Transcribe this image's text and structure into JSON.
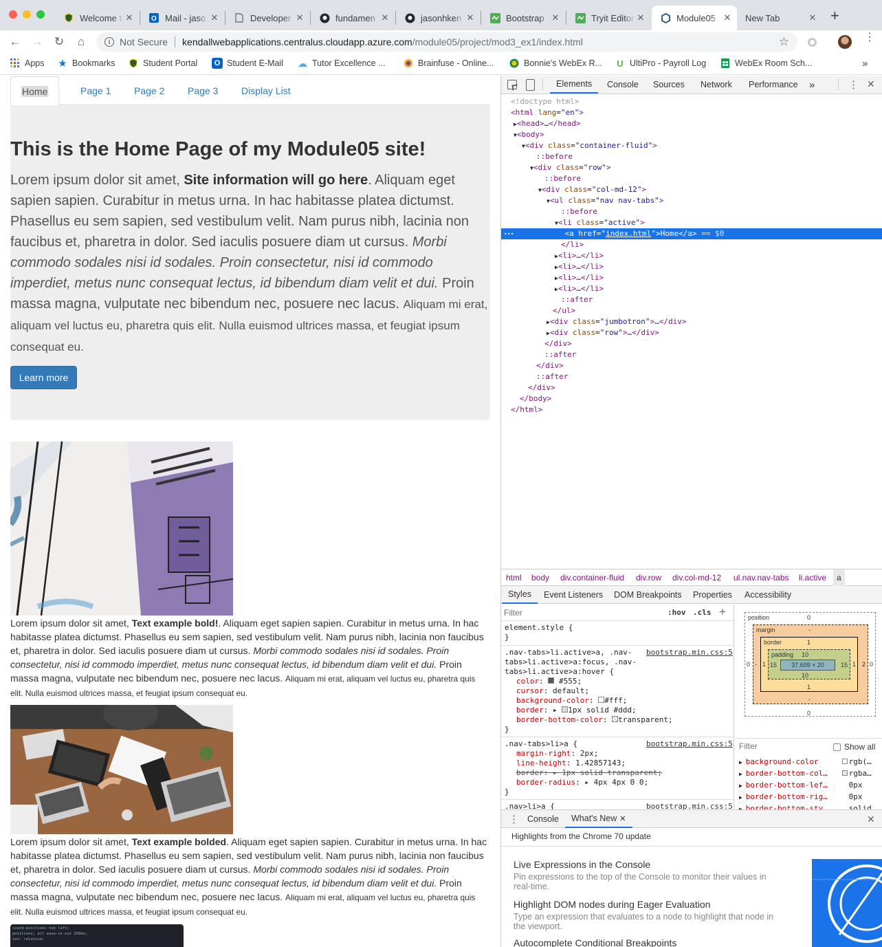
{
  "browser": {
    "tabs": [
      {
        "label": "Welcome t",
        "icon": "shield"
      },
      {
        "label": "Mail - jaso",
        "icon": "outlook"
      },
      {
        "label": "Developer",
        "icon": "doc"
      },
      {
        "label": "fundamen",
        "icon": "github"
      },
      {
        "label": "jasonhken",
        "icon": "github"
      },
      {
        "label": "Bootstrap",
        "icon": "tryit"
      },
      {
        "label": "Tryit Editor",
        "icon": "tryit"
      },
      {
        "label": "Module05",
        "icon": "azure"
      },
      {
        "label": "New Tab",
        "icon": ""
      }
    ],
    "security_label": "Not Secure",
    "url_host": "kendallwebapplications.centralus.cloudapp.azure.com",
    "url_path": "/module05/project/mod3_ex1/index.html",
    "bookmarks": [
      "Apps",
      "Bookmarks",
      "Student Portal",
      "Student E-Mail",
      "Tutor Excellence ...",
      "Brainfuse - Online...",
      "Bonnie's WebEx R...",
      "UltiPro - Payroll Log",
      "WebEx Room Sch..."
    ],
    "overflow_symbol": "»"
  },
  "site": {
    "nav": [
      "Home",
      "Page 1",
      "Page 2",
      "Page 3",
      "Display List"
    ],
    "heading": "This is the Home Page of my Module05 site!",
    "lead_1": "Lorem ipsum dolor sit amet, ",
    "lead_bold": "Site information will go here",
    "lead_2": ". Aliquam eget sapien sapien. Curabitur in metus urna. In hac habitasse platea dictumst. Phasellus eu sem sapien, sed vestibulum velit. Nam purus nibh, lacinia non faucibus et, pharetra in dolor. Sed iaculis posuere diam ut cursus. ",
    "lead_italic": "Morbi commodo sodales nisi id sodales. Proin consectetur, nisi id commodo imperdiet, metus nunc consequat lectus, id bibendum diam velit et dui.",
    "lead_3": " Proin massa magna, vulputate nec bibendum nec, posuere nec lacus. ",
    "lead_small": "Aliquam mi erat, aliquam vel luctus eu, pharetra quis elit. Nulla euismod ultrices massa, et feugiat ipsum consequat eu.",
    "learn_more": "Learn more",
    "para1_start": "Lorem ipsum dolor sit amet, ",
    "para1_bold": "Text example bold!",
    "para2_bold": "Text example bolded",
    "para_body": ". Aliquam eget sapien sapien. Curabitur in metus urna. In hac habitasse platea dictumst. Phasellus eu sem sapien, sed vestibulum velit. Nam purus nibh, lacinia non faucibus et, pharetra in dolor. Sed iaculis posuere diam ut cursus. ",
    "para_italic": "Morbi commodo sodales nisi id sodales. Proin consectetur, nisi id commodo imperdiet, metus nunc consequat lectus, id bibendum diam velit et dui.",
    "para_after": " Proin massa magna, vulputate nec bibendum nec, posuere nec lacus. ",
    "para_small": "Aliquam mi erat, aliquam vel luctus eu, pharetra quis elit. Nulla euismod ultrices massa, et feugiat ipsum consequat eu.",
    "code_lines": [
      "cound-positions top left;",
      "positions; all ease-in-out 250ms;",
      "ion: relative;"
    ]
  },
  "devtools": {
    "tabs": [
      "Elements",
      "Console",
      "Sources",
      "Network",
      "Performance"
    ],
    "more_symbol": "»",
    "dom": {
      "doctype": "<!doctype html>",
      "html_open": "html",
      "lang_attr": "lang",
      "lang_val": "\"en\"",
      "head": "head",
      "ellipsis": "…",
      "body": "body",
      "div": "div",
      "class_attr": "class",
      "container": "\"container-fluid\"",
      "row": "\"row\"",
      "col": "\"col-md-12\"",
      "ul": "ul",
      "navtabs": "\"nav nav-tabs\"",
      "li": "li",
      "active": "\"active\"",
      "a": "a",
      "href_attr": "href",
      "href_val": "index.html",
      "home": "Home",
      "sel_marker": "== $0",
      "before": "::before",
      "after": "::after",
      "jumbotron": "\"jumbotron\"",
      "dots": "•••"
    },
    "breadcrumbs": [
      "html",
      "body",
      "div.container-fluid",
      "div.row",
      "div.col-md-12",
      "ul.nav.nav-tabs",
      "li.active",
      "a"
    ],
    "subtabs": [
      "Styles",
      "Event Listeners",
      "DOM Breakpoints",
      "Properties",
      "Accessibility"
    ],
    "filter_placeholder": "Filter",
    "hov": ":hov",
    "cls": ".cls",
    "plus": "+",
    "styles": {
      "element_style": "element.style {",
      "close": "}",
      "rule1_sel": ".nav-tabs>li.active>a, .nav-tabs>li.active>a:focus, .nav-tabs>li.active>a:hover {",
      "rule1_src": "bootstrap.min.css:5",
      "rule1_props": [
        [
          "color",
          "#555;"
        ],
        [
          "cursor",
          "default;"
        ],
        [
          "background-color",
          "#fff;"
        ],
        [
          "border",
          "1px solid #ddd;"
        ],
        [
          "border-bottom-color",
          "transparent;"
        ]
      ],
      "rule2_sel": ".nav-tabs>li>a {",
      "rule2_src": "bootstrap.min.css:5",
      "rule2_props": [
        [
          "margin-right",
          "2px;"
        ],
        [
          "line-height",
          "1.42857143;"
        ],
        [
          "border",
          "1px solid transparent;"
        ],
        [
          "border-radius",
          "4px 4px 0 0;"
        ]
      ],
      "rule3_sel": ".nav>li>a {",
      "rule3_src": "bootstrap.min.css:5"
    },
    "boxmodel": {
      "position": "position",
      "margin": "margin",
      "border": "border",
      "padding": "padding",
      "content": "37.609 × 20",
      "pos_top": "0",
      "pos_bottom": "0",
      "pos_left": "0",
      "pos_right": "0",
      "margin_top": "-",
      "margin_bottom": "-",
      "margin_left": "-",
      "margin_right": "2",
      "border_top": "1",
      "border_bottom": "1",
      "border_left": "1",
      "border_right": "1",
      "padding_top": "10",
      "padding_bottom": "10",
      "padding_left": "15",
      "padding_right": "15"
    },
    "computed_filter": "Filter",
    "show_all": "Show all",
    "computed": [
      [
        "background-color",
        "rgb(…"
      ],
      [
        "border-bottom-col…",
        "rgba…"
      ],
      [
        "border-bottom-lef…",
        "0px"
      ],
      [
        "border-bottom-rig…",
        "0px"
      ],
      [
        "border-bottom-sty…",
        "solid"
      ]
    ],
    "drawer_tabs": [
      "Console",
      "What's New"
    ],
    "drawer_header": "Highlights from the Chrome 70 update",
    "whatsnew": [
      {
        "title": "Live Expressions in the Console",
        "desc": "Pin expressions to the top of the Console to monitor their values in real-time."
      },
      {
        "title": "Highlight DOM nodes during Eager Evaluation",
        "desc": "Type an expression that evaluates to a node to highlight that node in the viewport."
      },
      {
        "title": "Autocomplete Conditional Breakpoints",
        "desc": ""
      }
    ]
  },
  "colors": {
    "accent": "#1a73e8",
    "link": "#337ab7",
    "jumbotron": "#eeeeee",
    "button": "#337ab7"
  }
}
